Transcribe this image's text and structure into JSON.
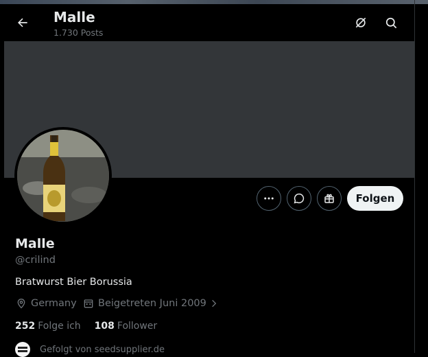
{
  "header": {
    "title": "Malle",
    "post_count": "1.730 Posts"
  },
  "profile": {
    "display_name": "Malle",
    "handle": "@crilind",
    "bio": "Bratwurst Bier Borussia",
    "location": "Germany",
    "joined": "Beigetreten Juni 2009",
    "following_count": "252",
    "following_label": "Folge ich",
    "followers_count": "108",
    "followers_label": "Follower",
    "followed_by": "Gefolgt von seedsupplier.de"
  },
  "actions": {
    "follow_label": "Folgen"
  },
  "icons": [
    "back-arrow-icon",
    "grok-icon",
    "search-icon",
    "more-icon",
    "message-icon",
    "gift-icon",
    "location-icon",
    "calendar-icon",
    "chevron-right-icon"
  ],
  "colors": {
    "background": "#000000",
    "banner": "#333639",
    "text_primary": "#e7e9ea",
    "text_secondary": "#71767b",
    "follow_button_bg": "#eff3f4"
  }
}
